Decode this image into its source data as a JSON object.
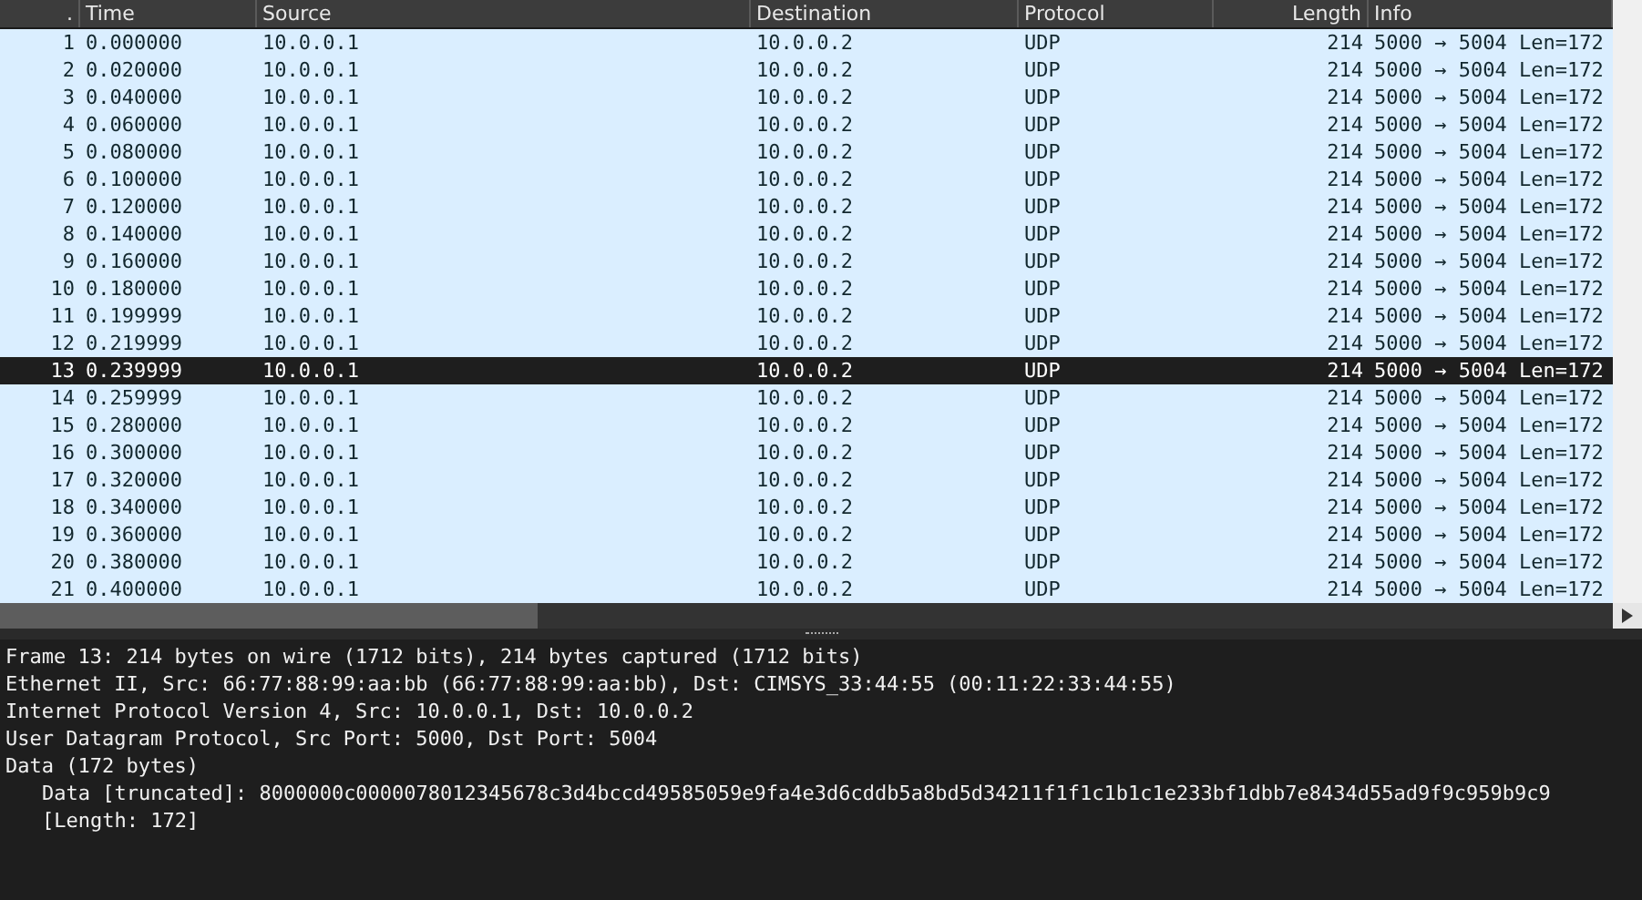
{
  "packet_list": {
    "columns": [
      {
        "label": "."
      },
      {
        "label": "Time"
      },
      {
        "label": "Source"
      },
      {
        "label": "Destination"
      },
      {
        "label": "Protocol"
      },
      {
        "label": "Length"
      },
      {
        "label": "Info"
      }
    ],
    "rows": [
      {
        "cells": [
          "1",
          "0.000000",
          "10.0.0.1",
          "10.0.0.2",
          "UDP",
          "214",
          "5000 → 5004 Len=172"
        ],
        "selected": false
      },
      {
        "cells": [
          "2",
          "0.020000",
          "10.0.0.1",
          "10.0.0.2",
          "UDP",
          "214",
          "5000 → 5004 Len=172"
        ],
        "selected": false
      },
      {
        "cells": [
          "3",
          "0.040000",
          "10.0.0.1",
          "10.0.0.2",
          "UDP",
          "214",
          "5000 → 5004 Len=172"
        ],
        "selected": false
      },
      {
        "cells": [
          "4",
          "0.060000",
          "10.0.0.1",
          "10.0.0.2",
          "UDP",
          "214",
          "5000 → 5004 Len=172"
        ],
        "selected": false
      },
      {
        "cells": [
          "5",
          "0.080000",
          "10.0.0.1",
          "10.0.0.2",
          "UDP",
          "214",
          "5000 → 5004 Len=172"
        ],
        "selected": false
      },
      {
        "cells": [
          "6",
          "0.100000",
          "10.0.0.1",
          "10.0.0.2",
          "UDP",
          "214",
          "5000 → 5004 Len=172"
        ],
        "selected": false
      },
      {
        "cells": [
          "7",
          "0.120000",
          "10.0.0.1",
          "10.0.0.2",
          "UDP",
          "214",
          "5000 → 5004 Len=172"
        ],
        "selected": false
      },
      {
        "cells": [
          "8",
          "0.140000",
          "10.0.0.1",
          "10.0.0.2",
          "UDP",
          "214",
          "5000 → 5004 Len=172"
        ],
        "selected": false
      },
      {
        "cells": [
          "9",
          "0.160000",
          "10.0.0.1",
          "10.0.0.2",
          "UDP",
          "214",
          "5000 → 5004 Len=172"
        ],
        "selected": false
      },
      {
        "cells": [
          "10",
          "0.180000",
          "10.0.0.1",
          "10.0.0.2",
          "UDP",
          "214",
          "5000 → 5004 Len=172"
        ],
        "selected": false
      },
      {
        "cells": [
          "11",
          "0.199999",
          "10.0.0.1",
          "10.0.0.2",
          "UDP",
          "214",
          "5000 → 5004 Len=172"
        ],
        "selected": false
      },
      {
        "cells": [
          "12",
          "0.219999",
          "10.0.0.1",
          "10.0.0.2",
          "UDP",
          "214",
          "5000 → 5004 Len=172"
        ],
        "selected": false
      },
      {
        "cells": [
          "13",
          "0.239999",
          "10.0.0.1",
          "10.0.0.2",
          "UDP",
          "214",
          "5000 → 5004 Len=172"
        ],
        "selected": true
      },
      {
        "cells": [
          "14",
          "0.259999",
          "10.0.0.1",
          "10.0.0.2",
          "UDP",
          "214",
          "5000 → 5004 Len=172"
        ],
        "selected": false
      },
      {
        "cells": [
          "15",
          "0.280000",
          "10.0.0.1",
          "10.0.0.2",
          "UDP",
          "214",
          "5000 → 5004 Len=172"
        ],
        "selected": false
      },
      {
        "cells": [
          "16",
          "0.300000",
          "10.0.0.1",
          "10.0.0.2",
          "UDP",
          "214",
          "5000 → 5004 Len=172"
        ],
        "selected": false
      },
      {
        "cells": [
          "17",
          "0.320000",
          "10.0.0.1",
          "10.0.0.2",
          "UDP",
          "214",
          "5000 → 5004 Len=172"
        ],
        "selected": false
      },
      {
        "cells": [
          "18",
          "0.340000",
          "10.0.0.1",
          "10.0.0.2",
          "UDP",
          "214",
          "5000 → 5004 Len=172"
        ],
        "selected": false
      },
      {
        "cells": [
          "19",
          "0.360000",
          "10.0.0.1",
          "10.0.0.2",
          "UDP",
          "214",
          "5000 → 5004 Len=172"
        ],
        "selected": false
      },
      {
        "cells": [
          "20",
          "0.380000",
          "10.0.0.1",
          "10.0.0.2",
          "UDP",
          "214",
          "5000 → 5004 Len=172"
        ],
        "selected": false
      },
      {
        "cells": [
          "21",
          "0.400000",
          "10.0.0.1",
          "10.0.0.2",
          "UDP",
          "214",
          "5000 → 5004 Len=172"
        ],
        "selected": false
      }
    ]
  },
  "packet_details": [
    {
      "text": "Frame 13: 214 bytes on wire (1712 bits), 214 bytes captured (1712 bits)"
    },
    {
      "text": "Ethernet II, Src: 66:77:88:99:aa:bb (66:77:88:99:aa:bb), Dst: CIMSYS_33:44:55 (00:11:22:33:44:55)"
    },
    {
      "text": "Internet Protocol Version 4, Src: 10.0.0.1, Dst: 10.0.0.2"
    },
    {
      "text": "User Datagram Protocol, Src Port: 5000, Dst Port: 5004"
    },
    {
      "text": "Data (172 bytes)",
      "children": [
        {
          "text": "Data [truncated]: 8000000c0000078012345678c3d4bccd49585059e9fa4e3d6cddb5a8bd5d34211f1f1c1b1c1e233bf1dbb7e8434d55ad9f9c959b9c9"
        },
        {
          "text": "[Length: 172]"
        }
      ]
    }
  ]
}
